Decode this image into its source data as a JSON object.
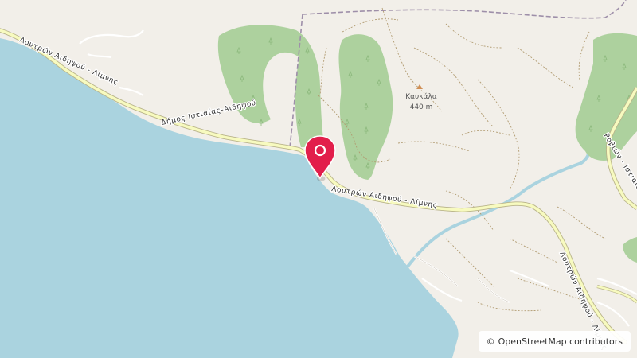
{
  "map": {
    "colors": {
      "land": "#f2efe9",
      "water": "#aad3df",
      "forest": "#add19e",
      "road": "#f7fabf",
      "road_casing": "#b9b48a",
      "track": "#b19b71",
      "boundary": "#9e8fa9",
      "pin": "#e21e4b"
    },
    "road_labels": {
      "coast_west": "Λουτρών Αιδηψού - Λίμνης",
      "coast_mid": "Δήμος Ιστιαίας-Αιδηψού",
      "main_east": "Λουτρών Αιδηψού - Λίμνης",
      "south_east": "Λουτρών Αιδηψού - Λίμνης",
      "north_east": "Ροβιών - Ιστιαίας",
      "edge_cut": "Ροβιών - Ιστιαίας"
    },
    "peak": {
      "name": "Καυκάλα",
      "elevation": "440 m",
      "icon": "peak-triangle-icon"
    },
    "marker": {
      "icon": "map-pin-icon"
    },
    "attribution": {
      "symbol": "©",
      "text": "OpenStreetMap contributors"
    }
  }
}
